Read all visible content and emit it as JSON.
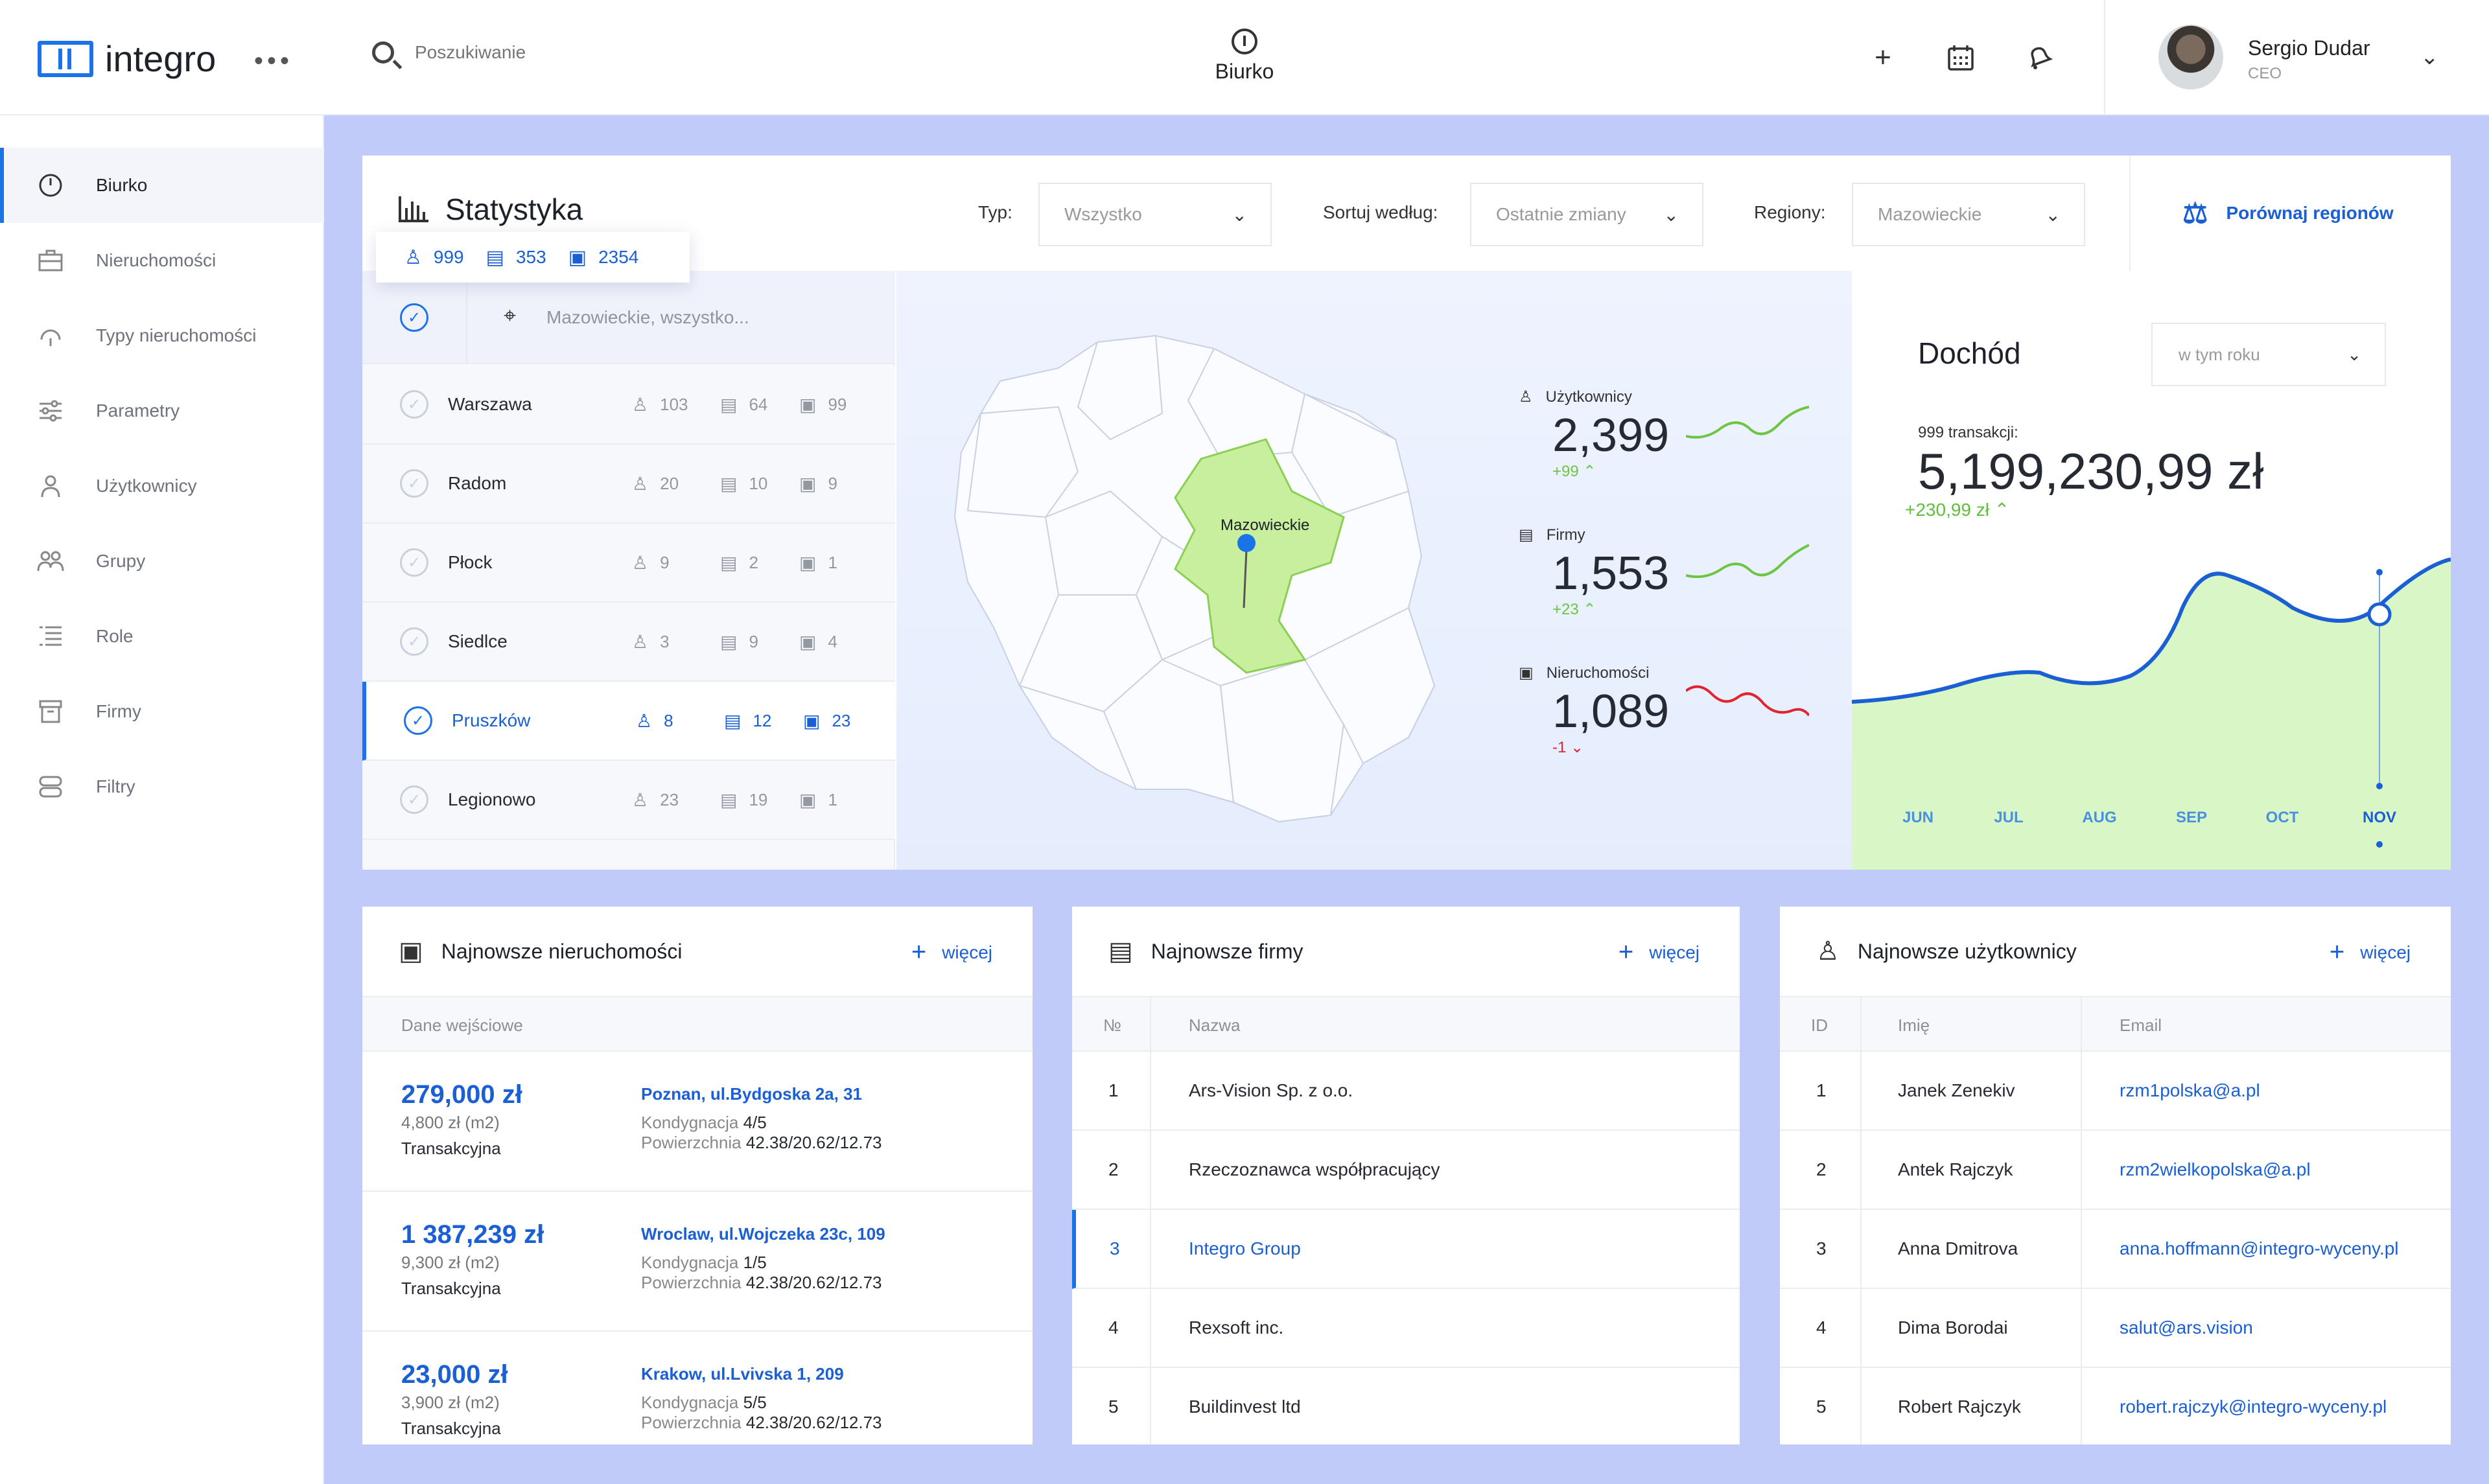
{
  "app": {
    "name": "integro"
  },
  "search": {
    "placeholder": "Poszukiwanie"
  },
  "header": {
    "center_label": "Biurko"
  },
  "user": {
    "name": "Sergio Dudar",
    "role": "CEO"
  },
  "sidebar": {
    "items": [
      {
        "label": "Biurko",
        "icon": "gauge-icon",
        "active": true
      },
      {
        "label": "Nieruchomości",
        "icon": "briefcase-icon"
      },
      {
        "label": "Typy nieruchomości",
        "icon": "gauge-pin-icon"
      },
      {
        "label": "Parametry",
        "icon": "sliders-icon"
      },
      {
        "label": "Użytkownicy",
        "icon": "user-icon"
      },
      {
        "label": "Grupy",
        "icon": "users-icon"
      },
      {
        "label": "Role",
        "icon": "list-icon"
      },
      {
        "label": "Firmy",
        "icon": "archive-icon"
      },
      {
        "label": "Filtry",
        "icon": "server-icon"
      }
    ]
  },
  "stats": {
    "title": "Statystyka",
    "filters": {
      "typ_label": "Typ:",
      "typ_value": "Wszystko",
      "sort_label": "Sortuj według:",
      "sort_value": "Ostatnie zmiany",
      "region_label": "Regiony:",
      "region_value": "Mazowieckie"
    },
    "compare_label": "Porównaj regionów",
    "counts": {
      "users": "999",
      "firms": "353",
      "properties": "2354"
    },
    "region_search": "Mazowieckie, wszystko...",
    "regions": [
      {
        "name": "Warszawa",
        "users": "103",
        "firms": "64",
        "props": "99"
      },
      {
        "name": "Radom",
        "users": "20",
        "firms": "10",
        "props": "9"
      },
      {
        "name": "Płock",
        "users": "9",
        "firms": "2",
        "props": "1"
      },
      {
        "name": "Siedlce",
        "users": "3",
        "firms": "9",
        "props": "4"
      },
      {
        "name": "Pruszków",
        "users": "8",
        "firms": "12",
        "props": "23",
        "selected": true
      },
      {
        "name": "Legionowo",
        "users": "23",
        "firms": "19",
        "props": "1"
      }
    ],
    "map_label": "Mazowieckie",
    "metrics": [
      {
        "label": "Użytkownicy",
        "value": "2,399",
        "delta": "+99",
        "trend": "up",
        "color": "#6cc644"
      },
      {
        "label": "Firmy",
        "value": "1,553",
        "delta": "+23",
        "trend": "up",
        "color": "#6cc644"
      },
      {
        "label": "Nieruchomości",
        "value": "1,089",
        "delta": "-1",
        "trend": "down",
        "color": "#e2242f"
      }
    ]
  },
  "income": {
    "title": "Dochód",
    "period": "w tym roku",
    "sub": "999 transakcji:",
    "value": "5,199,230,99 zł",
    "delta": "+230,99 zł",
    "months": [
      "JUN",
      "JUL",
      "AUG",
      "SEP",
      "OCT",
      "NOV"
    ],
    "active_month": "NOV",
    "line_color": "#1a5fd4",
    "fill_color": "#d9f7c6"
  },
  "props_card": {
    "title": "Najnowsze nieruchomości",
    "more": "więcej",
    "col": "Dane wejściowe",
    "floor_label": "Kondygnacja",
    "area_label": "Powierzchnia",
    "items": [
      {
        "price": "279,000 zł",
        "m2": "4,800 zł (m2)",
        "type": "Transakcyjna",
        "address": "Poznan, ul.Bydgoska 2a, 31",
        "floor": "4/5",
        "area": "42.38/20.62/12.73"
      },
      {
        "price": "1 387,239 zł",
        "m2": "9,300 zł (m2)",
        "type": "Transakcyjna",
        "address": "Wroclaw, ul.Wojczeka 23c, 109",
        "floor": "1/5",
        "area": "42.38/20.62/12.73"
      },
      {
        "price": "23,000 zł",
        "m2": "3,900 zł (m2)",
        "type": "Transakcyjna",
        "address": "Krakow, ul.Lvivska 1, 209",
        "floor": "5/5",
        "area": "42.38/20.62/12.73"
      }
    ]
  },
  "firms_card": {
    "title": "Najnowsze firmy",
    "more": "więcej",
    "col_no": "№",
    "col_name": "Nazwa",
    "rows": [
      {
        "no": "1",
        "name": "Ars-Vision Sp. z o.o."
      },
      {
        "no": "2",
        "name": "Rzeczoznawca współpracujący"
      },
      {
        "no": "3",
        "name": "Integro Group",
        "selected": true
      },
      {
        "no": "4",
        "name": "Rexsoft inc."
      },
      {
        "no": "5",
        "name": "Buildinvest ltd"
      }
    ]
  },
  "users_card": {
    "title": "Najnowsze użytkownicy",
    "more": "więcej",
    "col_id": "ID",
    "col_name": "Imię",
    "col_email": "Email",
    "rows": [
      {
        "id": "1",
        "name": "Janek Zenekiv",
        "email": "rzm1polska@a.pl"
      },
      {
        "id": "2",
        "name": "Antek Rajczyk",
        "email": "rzm2wielkopolska@a.pl"
      },
      {
        "id": "3",
        "name": "Anna Dmitrova",
        "email": "anna.hoffmann@integro-wyceny.pl"
      },
      {
        "id": "4",
        "name": "Dima Borodai",
        "email": "salut@ars.vision"
      },
      {
        "id": "5",
        "name": "Robert Rajczyk",
        "email": "robert.rajczyk@integro-wyceny.pl"
      }
    ]
  }
}
